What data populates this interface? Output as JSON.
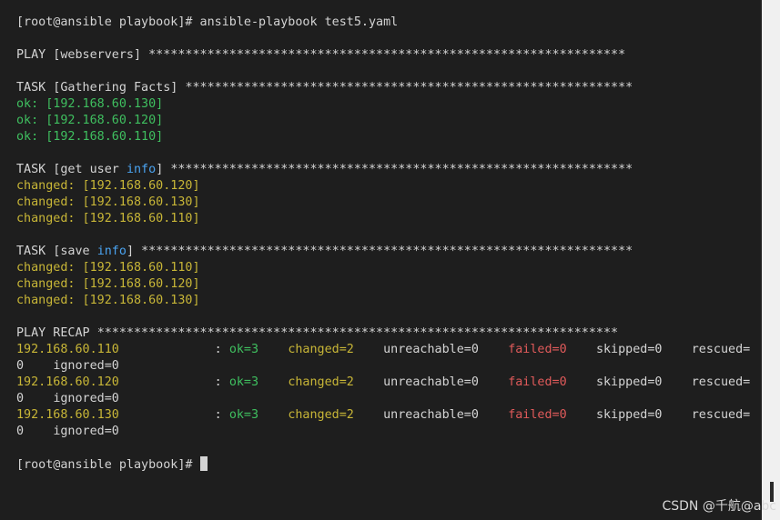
{
  "terminal": {
    "prompt": "[root@ansible playbook]# ",
    "command": "ansible-playbook test5.yaml",
    "stars_short": "*********************************************************",
    "play_header": "PLAY [webservers] ",
    "play_stars": "*****************************************************************",
    "task1_header": "TASK [Gathering Facts] ",
    "task1_stars": "*************************************************************",
    "task1_results": [
      "ok: [192.168.60.130]",
      "ok: [192.168.60.120]",
      "ok: [192.168.60.110]"
    ],
    "task2_pre": "TASK [get user ",
    "task2_kw": "info",
    "task2_post": "] ",
    "task2_stars": "***************************************************************",
    "task2_results": [
      "changed: [192.168.60.120]",
      "changed: [192.168.60.130]",
      "changed: [192.168.60.110]"
    ],
    "task3_pre": "TASK [save ",
    "task3_kw": "info",
    "task3_post": "] ",
    "task3_stars": "*******************************************************************",
    "task3_results": [
      "changed: [192.168.60.110]",
      "changed: [192.168.60.120]",
      "changed: [192.168.60.130]"
    ],
    "recap_header": "PLAY RECAP ",
    "recap_stars": "***********************************************************************",
    "recap": [
      {
        "host": "192.168.60.110",
        "ok": "ok=3",
        "changed": "changed=2",
        "unreachable": "unreachable=0",
        "failed": "failed=0",
        "skipped": "skipped=0",
        "rescued": "rescued=",
        "wrap_zero": "0",
        "ignored": "ignored=0"
      },
      {
        "host": "192.168.60.120",
        "ok": "ok=3",
        "changed": "changed=2",
        "unreachable": "unreachable=0",
        "failed": "failed=0",
        "skipped": "skipped=0",
        "rescued": "rescued=",
        "wrap_zero": "0",
        "ignored": "ignored=0"
      },
      {
        "host": "192.168.60.130",
        "ok": "ok=3",
        "changed": "changed=2",
        "unreachable": "unreachable=0",
        "failed": "failed=0",
        "skipped": "skipped=0",
        "rescued": "rescued=",
        "wrap_zero": "0",
        "ignored": "ignored=0"
      }
    ],
    "final_prompt": "[root@ansible playbook]# "
  },
  "watermark": "CSDN @千航@abc",
  "colors": {
    "background": "#1e1e1e",
    "ok": "#3fbf5f",
    "changed": "#c8b637",
    "failed": "#e05a5a",
    "keyword": "#4aa3f0"
  }
}
